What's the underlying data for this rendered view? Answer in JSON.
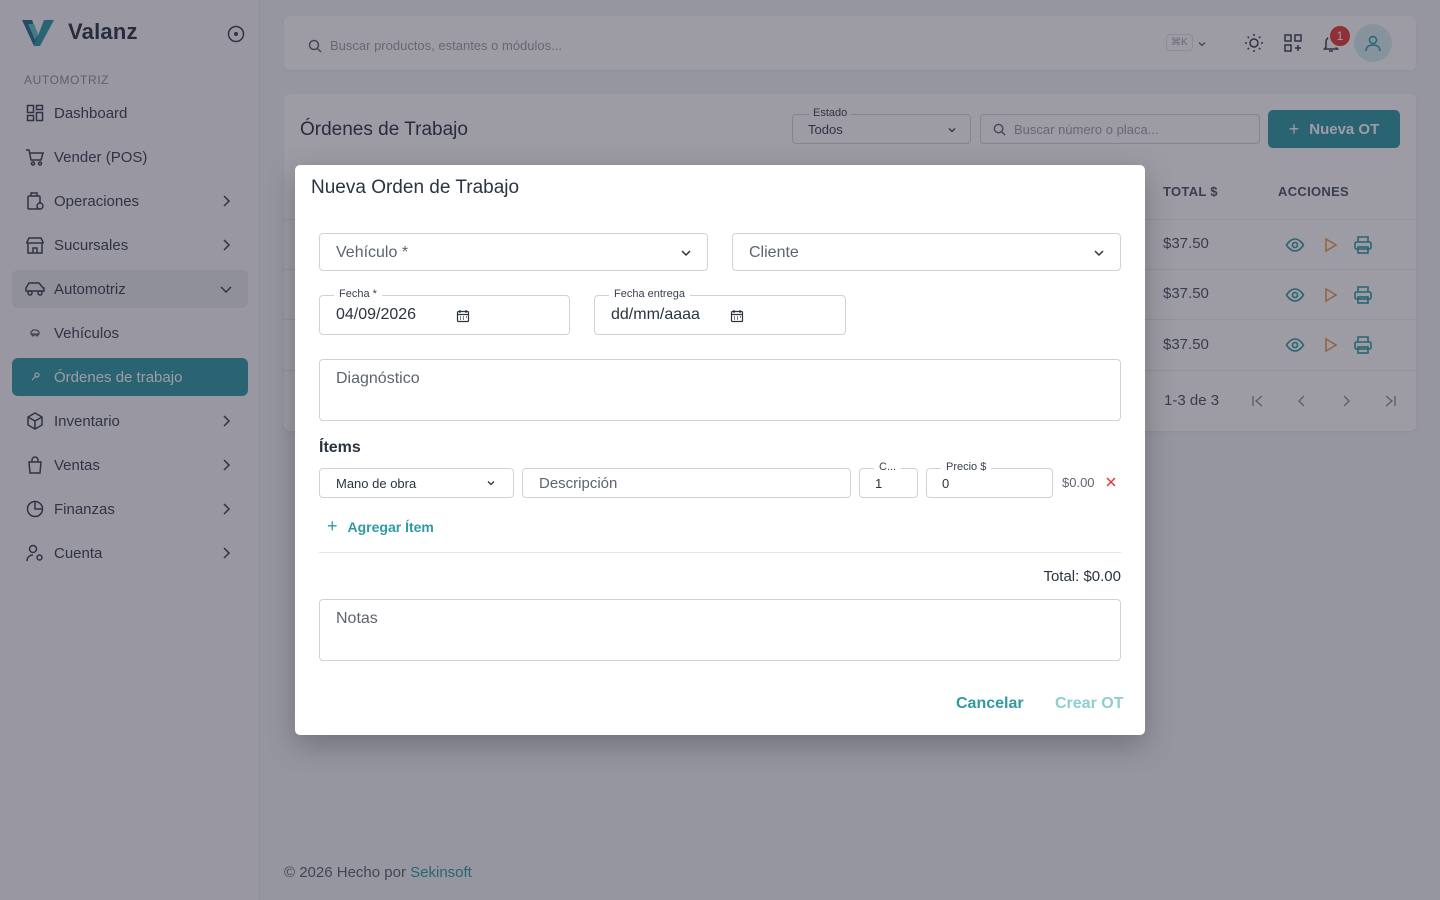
{
  "brand": {
    "name": "Valanz"
  },
  "sidebar": {
    "section": "AUTOMOTRIZ",
    "items": [
      {
        "label": "Dashboard",
        "icon": "dashboard-icon"
      },
      {
        "label": "Vender (POS)",
        "icon": "cart-icon"
      },
      {
        "label": "Operaciones",
        "icon": "operations-icon"
      },
      {
        "label": "Sucursales",
        "icon": "store-icon"
      },
      {
        "label": "Automotriz",
        "icon": "car-icon"
      },
      {
        "label": "Vehículos",
        "icon": "dot-icon"
      },
      {
        "label": "Órdenes de trabajo",
        "icon": "wrench-icon"
      },
      {
        "label": "Inventario",
        "icon": "box-icon"
      },
      {
        "label": "Ventas",
        "icon": "bag-icon"
      },
      {
        "label": "Finanzas",
        "icon": "pie-icon"
      },
      {
        "label": "Cuenta",
        "icon": "user-gear-icon"
      }
    ]
  },
  "topbar": {
    "search_placeholder": "Buscar productos, estantes o módulos...",
    "shortcut": "⌘K",
    "notifications": "1"
  },
  "page": {
    "title": "Órdenes de Trabajo",
    "estado_label": "Estado",
    "estado_value": "Todos",
    "search_placeholder": "Buscar número o placa...",
    "new_button": "Nueva OT",
    "columns": {
      "total": "TOTAL $",
      "actions": "ACCIONES"
    },
    "rows": [
      {
        "total": "$37.50"
      },
      {
        "total": "$37.50"
      },
      {
        "total": "$37.50"
      }
    ],
    "pagination": "1-3 de 3"
  },
  "footer": {
    "prefix": "© 2026 Hecho por ",
    "link": "Sekinsoft"
  },
  "modal": {
    "title": "Nueva Orden de Trabajo",
    "vehicle_placeholder": "Vehículo *",
    "client_placeholder": "Cliente",
    "date_label": "Fecha *",
    "date_value": "04/09/2026",
    "delivery_label": "Fecha entrega",
    "delivery_value": "dd/mm/aaaa",
    "diagnosis_placeholder": "Diagnóstico",
    "items_title": "Ítems",
    "item": {
      "type": "Mano de obra",
      "description_placeholder": "Descripción",
      "qty_label": "C...",
      "qty_value": "1",
      "price_label": "Precio $",
      "price_value": "0",
      "line_total": "$0.00"
    },
    "add_item": "Agregar Ítem",
    "total": "Total: $0.00",
    "notes_placeholder": "Notas",
    "cancel": "Cancelar",
    "create": "Crear OT"
  },
  "colors": {
    "accent": "#2f9aa2",
    "danger": "#e53935",
    "warning": "#f2994a"
  }
}
